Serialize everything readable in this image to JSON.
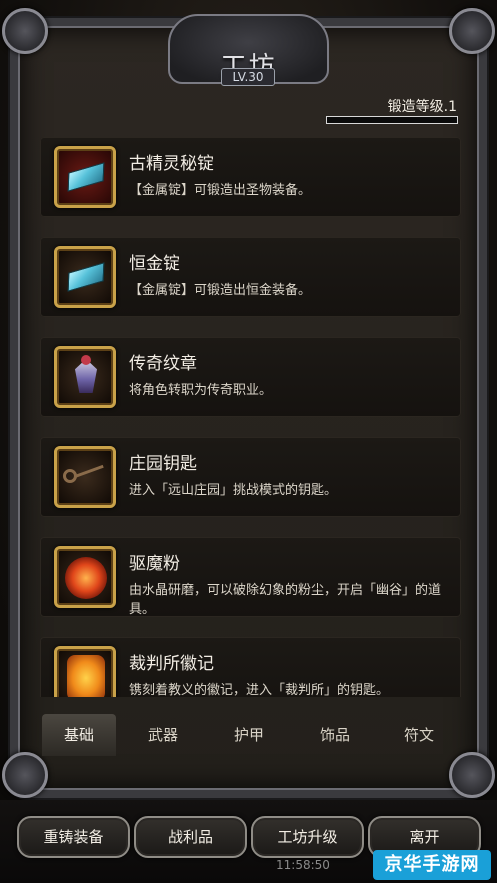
{
  "window": {
    "title": "工坊",
    "level": "LV.30"
  },
  "forge": {
    "label": "锻造等级.1",
    "progress": 0.0
  },
  "items": [
    {
      "name": "古精灵秘锭",
      "desc": "【金属锭】可锻造出圣物装备。",
      "icon": "ancient-elf-ingot-icon"
    },
    {
      "name": "恒金锭",
      "desc": "【金属锭】可锻造出恒金装备。",
      "icon": "eternal-gold-ingot-icon"
    },
    {
      "name": "传奇纹章",
      "desc": "将角色转职为传奇职业。",
      "icon": "legendary-emblem-icon"
    },
    {
      "name": "庄园钥匙",
      "desc": "进入「远山庄园」挑战模式的钥匙。",
      "icon": "manor-key-icon"
    },
    {
      "name": "驱魔粉",
      "desc": "由水晶研磨，可以破除幻象的粉尘，开启「幽谷」的道具。",
      "icon": "exorcism-powder-icon"
    },
    {
      "name": "裁判所徽记",
      "desc": "镌刻着教义的徽记，进入「裁判所」的钥匙。",
      "icon": "inquisition-emblem-icon"
    }
  ],
  "tabs": [
    "基础",
    "武器",
    "护甲",
    "饰品",
    "符文"
  ],
  "active_tab": "基础",
  "buttons": {
    "reforge": "重铸装备",
    "loot": "战利品",
    "upgrade": "工坊升级",
    "leave": "离开"
  },
  "status": {
    "clock": "11:58:50"
  },
  "watermark": "京华手游网"
}
